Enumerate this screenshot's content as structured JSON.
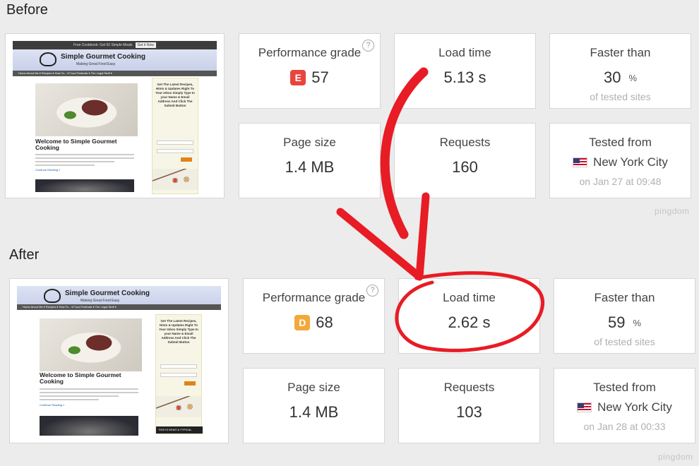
{
  "before": {
    "title": "Before",
    "cards": {
      "performance": {
        "label": "Performance grade",
        "grade": "E",
        "grade_color": "#e8453c",
        "score": "57",
        "help": "?"
      },
      "load_time": {
        "label": "Load time",
        "value": "5.13 s"
      },
      "faster_than": {
        "label": "Faster than",
        "value": "30",
        "unit": "%",
        "sub": "of tested sites"
      },
      "page_size": {
        "label": "Page size",
        "value": "1.4 MB"
      },
      "requests": {
        "label": "Requests",
        "value": "160"
      },
      "tested_from": {
        "label": "Tested from",
        "location": "New York City",
        "date": "on Jan 27 at 09:48"
      }
    },
    "watermark": "pingdom"
  },
  "after": {
    "title": "After",
    "cards": {
      "performance": {
        "label": "Performance grade",
        "grade": "D",
        "grade_color": "#f2a83b",
        "score": "68",
        "help": "?"
      },
      "load_time": {
        "label": "Load time",
        "value": "2.62 s"
      },
      "faster_than": {
        "label": "Faster than",
        "value": "59",
        "unit": "%",
        "sub": "of tested sites"
      },
      "page_size": {
        "label": "Page size",
        "value": "1.4 MB"
      },
      "requests": {
        "label": "Requests",
        "value": "103"
      },
      "tested_from": {
        "label": "Tested from",
        "location": "New York City",
        "date": "on Jan 28 at 00:33"
      }
    },
    "watermark": "pingdom"
  },
  "site_preview": {
    "logo_title": "Simple Gourmet Cooking",
    "logo_tagline": "Making Great Food Easy",
    "nav": "Home   About Me ▾   Recipes ▾   How To... ▾   Food Festivals ▾   The Legal Stuff ▾",
    "headline": "Welcome to Simple Gourmet Cooking",
    "read_more": "Continue Reading »",
    "sidebar_text": "Get The Latest Recipes, Hints & Updates Right To Your Inbox Simply Type In your Name & Email Address And Click The Submit Button",
    "topbar_text": "Free Cookbook: Get 50 Simple Meals",
    "topbar_button": "Get it Now",
    "ad_text": "THIS IS WHAT A TYPICAL"
  },
  "colors": {
    "annotation": "#e81c24",
    "card_border": "#d6d6d6",
    "background": "#ececec"
  }
}
